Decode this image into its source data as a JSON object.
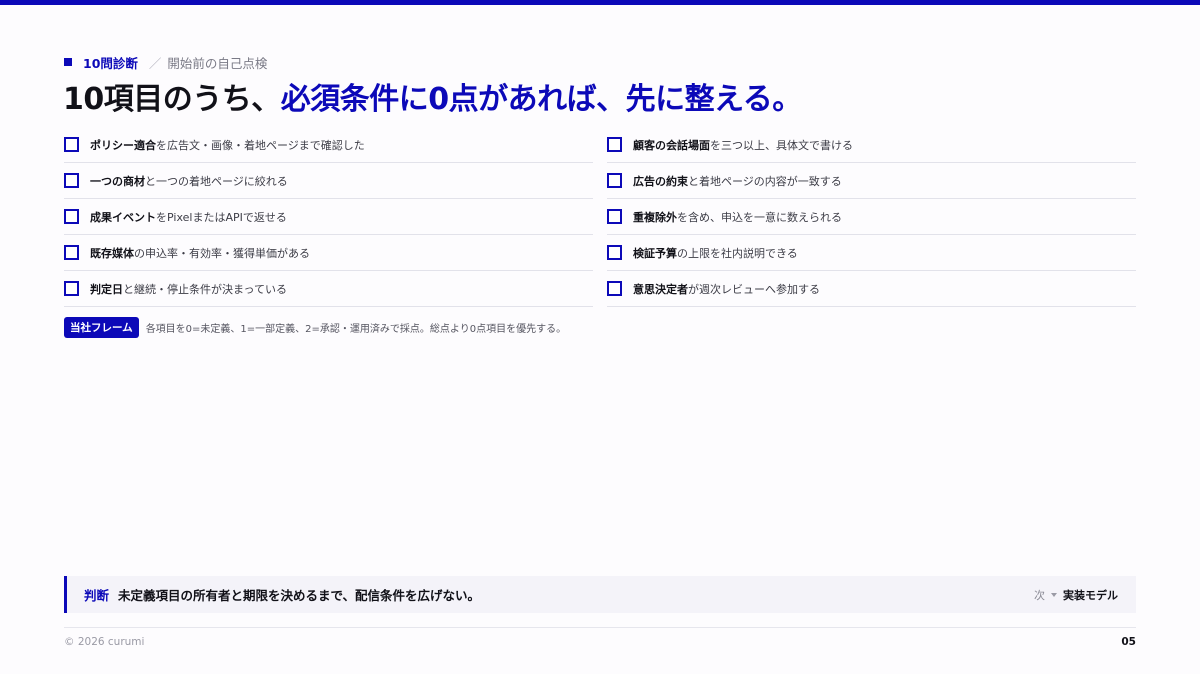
{
  "eyebrow": {
    "label": "10問診断",
    "subtitle": "開始前の自己点検"
  },
  "headline": {
    "part1": "10項目のうち、",
    "accent": "必須条件に0点があれば、先に整える。"
  },
  "checklist": {
    "left": [
      {
        "strong": "ポリシー適合",
        "rest": "を広告文・画像・着地ページまで確認した"
      },
      {
        "strong": "一つの商材",
        "rest": "と一つの着地ページに絞れる"
      },
      {
        "strong": "成果イベント",
        "rest": "をPixelまたはAPIで返せる"
      },
      {
        "strong": "既存媒体",
        "rest": "の申込率・有効率・獲得単価がある"
      },
      {
        "strong": "判定日",
        "rest": "と継続・停止条件が決まっている"
      }
    ],
    "right": [
      {
        "strong": "顧客の会話場面",
        "rest": "を三つ以上、具体文で書ける"
      },
      {
        "strong": "広告の約束",
        "rest": "と着地ページの内容が一致する"
      },
      {
        "strong": "重複除外",
        "rest": "を含め、申込を一意に数えられる"
      },
      {
        "strong": "検証予算",
        "rest": "の上限を社内説明できる"
      },
      {
        "strong": "意思決定者",
        "rest": "が週次レビューへ参加する"
      }
    ]
  },
  "note": {
    "badge": "当社フレーム",
    "text": "各項目を0=未定義、1=一部定義、2=承認・運用済みで採点。総点より0点項目を優先する。"
  },
  "callout": {
    "label": "判断",
    "text": "未定義項目の所有者と期限を決めるまで、配信条件を広げない。",
    "next_label": "次",
    "next_target": "実装モデル"
  },
  "footer": {
    "copyright": "© 2026 curumi",
    "page": "05"
  },
  "colors": {
    "accent": "#0c09b8",
    "text": "#111118",
    "background": "#fdfcfe"
  }
}
